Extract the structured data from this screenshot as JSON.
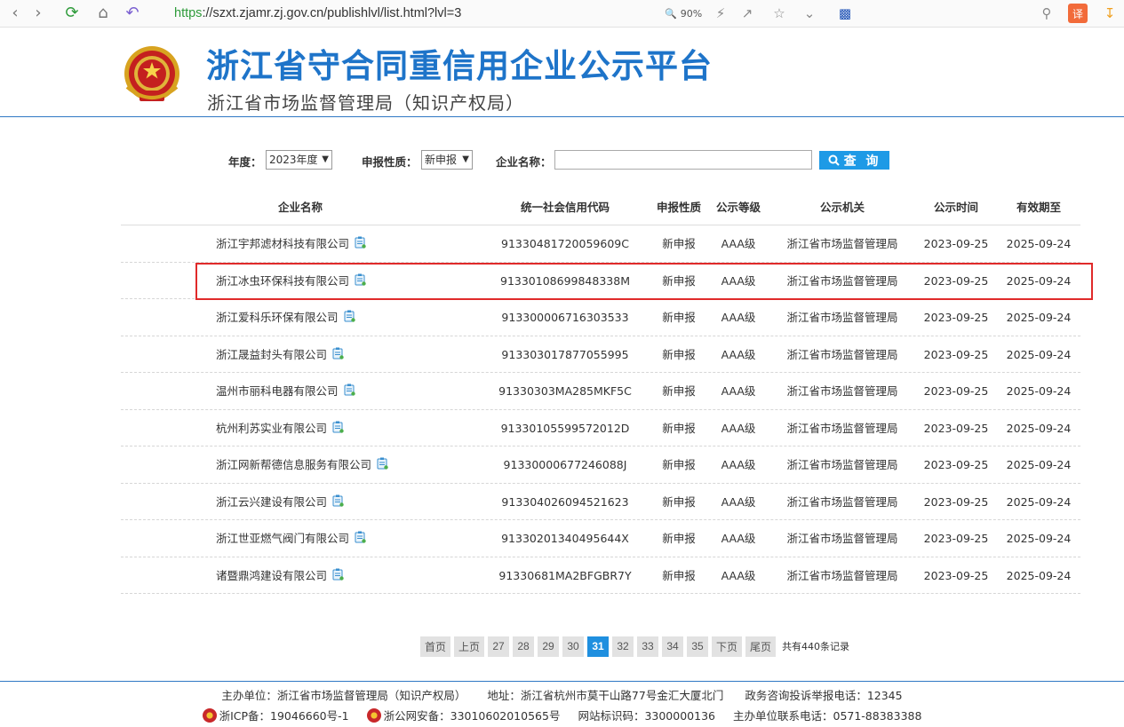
{
  "browser": {
    "url_scheme": "https",
    "url_rest": "://szxt.zjamr.zj.gov.cn/publishlvl/list.html?lvl=3",
    "zoom": "90%"
  },
  "header": {
    "title": "浙江省守合同重信用企业公示平台",
    "subtitle": "浙江省市场监督管理局（知识产权局）"
  },
  "filters": {
    "year_label": "年度：",
    "year_value": "2023年度",
    "type_label": "申报性质：",
    "type_value": "新申报",
    "name_label": "企业名称：",
    "name_value": "",
    "search_label": "查 询"
  },
  "table": {
    "headers": [
      "企业名称",
      "统一社会信用代码",
      "申报性质",
      "公示等级",
      "公示机关",
      "公示时间",
      "有效期至"
    ],
    "rows": [
      {
        "name": "浙江宇邦滤材科技有限公司",
        "code": "91330481720059609C",
        "type": "新申报",
        "level": "AAA级",
        "org": "浙江省市场监督管理局",
        "pub": "2023-09-25",
        "exp": "2025-09-24"
      },
      {
        "name": "浙江冰虫环保科技有限公司",
        "code": "91330108699848338M",
        "type": "新申报",
        "level": "AAA级",
        "org": "浙江省市场监督管理局",
        "pub": "2023-09-25",
        "exp": "2025-09-24"
      },
      {
        "name": "浙江爱科乐环保有限公司",
        "code": "913300006716303533",
        "type": "新申报",
        "level": "AAA级",
        "org": "浙江省市场监督管理局",
        "pub": "2023-09-25",
        "exp": "2025-09-24"
      },
      {
        "name": "浙江晟益封头有限公司",
        "code": "913303017877055995",
        "type": "新申报",
        "level": "AAA级",
        "org": "浙江省市场监督管理局",
        "pub": "2023-09-25",
        "exp": "2025-09-24"
      },
      {
        "name": "温州市丽科电器有限公司",
        "code": "91330303MA285MKF5C",
        "type": "新申报",
        "level": "AAA级",
        "org": "浙江省市场监督管理局",
        "pub": "2023-09-25",
        "exp": "2025-09-24"
      },
      {
        "name": "杭州利苏实业有限公司",
        "code": "91330105599572012D",
        "type": "新申报",
        "level": "AAA级",
        "org": "浙江省市场监督管理局",
        "pub": "2023-09-25",
        "exp": "2025-09-24"
      },
      {
        "name": "浙江网新帮德信息服务有限公司",
        "code": "91330000677246088J",
        "type": "新申报",
        "level": "AAA级",
        "org": "浙江省市场监督管理局",
        "pub": "2023-09-25",
        "exp": "2025-09-24"
      },
      {
        "name": "浙江云兴建设有限公司",
        "code": "913304026094521623",
        "type": "新申报",
        "level": "AAA级",
        "org": "浙江省市场监督管理局",
        "pub": "2023-09-25",
        "exp": "2025-09-24"
      },
      {
        "name": "浙江世亚燃气阀门有限公司",
        "code": "91330201340495644X",
        "type": "新申报",
        "level": "AAA级",
        "org": "浙江省市场监督管理局",
        "pub": "2023-09-25",
        "exp": "2025-09-24"
      },
      {
        "name": "诸暨鼎鸿建设有限公司",
        "code": "91330681MA2BFGBR7Y",
        "type": "新申报",
        "level": "AAA级",
        "org": "浙江省市场监督管理局",
        "pub": "2023-09-25",
        "exp": "2025-09-24"
      }
    ]
  },
  "pagination": {
    "first": "首页",
    "prev": "上页",
    "pages": [
      "27",
      "28",
      "29",
      "30",
      "31",
      "32",
      "33",
      "34",
      "35"
    ],
    "current": "31",
    "next": "下页",
    "last": "尾页",
    "total": "共有440条记录"
  },
  "footer": {
    "sponsor": "主办单位：浙江省市场监督管理局（知识产权局）",
    "address": "地址：浙江省杭州市莫干山路77号金汇大厦北门",
    "hotline": "政务咨询投诉举报电话：12345",
    "icp": "浙ICP备：19046660号-1",
    "police": "浙公网安备：33010602010565号",
    "site_id": "网站标识码：3300000136",
    "contact": "主办单位联系电话：0571-88383388"
  },
  "colors": {
    "brand_blue": "#1e74c9",
    "accent_blue": "#1e9ae6",
    "highlight_red": "#e02a2a",
    "url_green": "#2e9b3a"
  }
}
